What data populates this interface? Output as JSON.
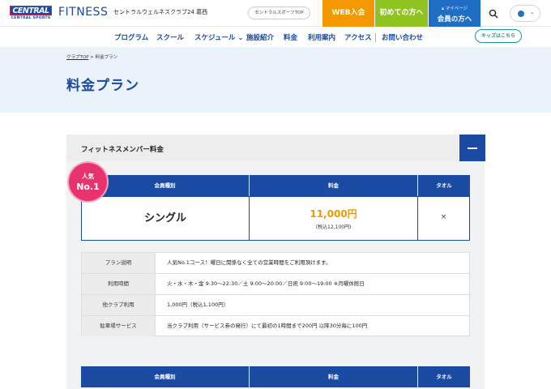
{
  "header": {
    "logo_top": "CENTRAL",
    "logo_bottom": "CENTRAL SPORTS",
    "brand": "FITNESS",
    "club_name": "セントラルウェルネスクラブ24 葛西",
    "sports_top_label": "セントラルスポーツTOP",
    "web_join_label": "WEB入会",
    "first_time_label": "初めての方へ",
    "mypage_label": "マイページ",
    "member_label": "会員の方へ",
    "icons": {
      "search": "search-icon",
      "language": "globe-icon",
      "dropdown": "chevron-down-icon",
      "mypage": "lock-icon"
    },
    "colors": {
      "brand": "#1a4aa2",
      "web_join": "#f39800",
      "first_time": "#8fc31f",
      "member": "#1f6dc4"
    }
  },
  "nav": {
    "items": [
      "プログラム",
      "スクール",
      "スケジュール",
      "施設紹介",
      "料金",
      "利用案内",
      "アクセス",
      "お問い合わせ"
    ],
    "schedule_arrow": "⌄",
    "kids_label": "キッズはこちら"
  },
  "breadcrumb": {
    "home": "クラブTOP",
    "separator": ">",
    "current": "料金プラン"
  },
  "page_title": "料金プラン",
  "section": {
    "title": "フィットネスメンバー料金",
    "collapse_icon": "minus-icon",
    "table_headers": [
      "会員種別",
      "料金",
      "タオル"
    ],
    "badge_line1": "人気",
    "badge_line2": "No.1",
    "plan": {
      "name": "シングル",
      "price": "11,000円",
      "price_tax": "(税込12,100円)",
      "towel": "×"
    },
    "details": [
      {
        "label": "プラン説明",
        "value": "人気No.1コース！曜日に関係なく全ての営業時間をご利用頂けます。"
      },
      {
        "label": "利用時間",
        "value": "火・水・木・金 9:30〜22:30／土 9:00〜20:00／日祝 9:00〜19:00 ※月曜休館日"
      },
      {
        "label": "他クラブ利用",
        "value": "1,000円（税込1,100円）"
      },
      {
        "label": "駐車場サービス",
        "value": "当クラブ利用（サービス券の発行）にて最初の1時間まで200円 以降30分毎に100円"
      }
    ],
    "second_table_headers": [
      "会員種別",
      "料金",
      "タオル"
    ]
  }
}
